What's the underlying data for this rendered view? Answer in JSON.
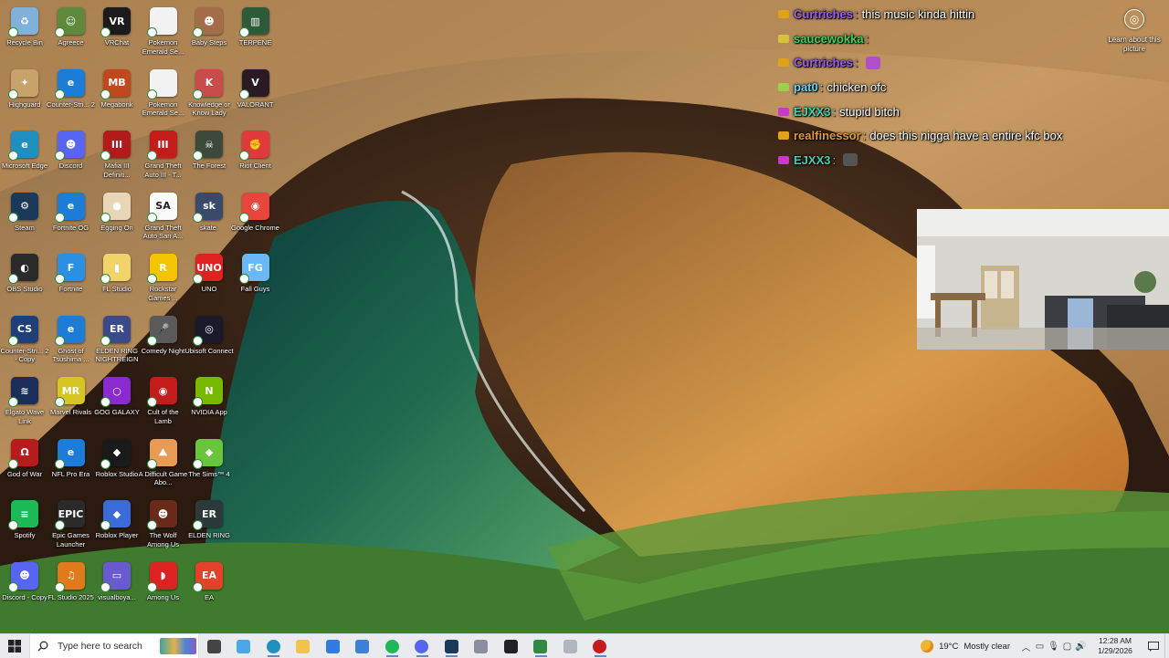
{
  "desktop": {
    "icons": [
      {
        "label": "Recycle Bin",
        "color": "#7fb1d9",
        "glyph": "♻"
      },
      {
        "label": "Agreece",
        "color": "#5f8a3e",
        "glyph": "☺"
      },
      {
        "label": "VRChat",
        "color": "#1b1b1b",
        "glyph": "VR"
      },
      {
        "label": "Pokemon Emerald Se...",
        "color": "#f2f2f2",
        "glyph": ""
      },
      {
        "label": "Baby Steps",
        "color": "#a36d4a",
        "glyph": "☻"
      },
      {
        "label": "TERPENE",
        "color": "#2f5a3a",
        "glyph": "▥"
      },
      {
        "label": "Highguard",
        "color": "#c9a26b",
        "glyph": "✦"
      },
      {
        "label": "Counter-Stri... 2",
        "color": "#1b7dd8",
        "glyph": "e"
      },
      {
        "label": "Megabonk",
        "color": "#c1481e",
        "glyph": "MB"
      },
      {
        "label": "Pokemon Emerald Se...",
        "color": "#f2f2f2",
        "glyph": ""
      },
      {
        "label": "Knowledge or Know Lady",
        "color": "#c94b4b",
        "glyph": "K"
      },
      {
        "label": "VALORANT",
        "color": "#2a1a24",
        "glyph": "V"
      },
      {
        "label": "Microsoft Edge",
        "color": "#1f8fbf",
        "glyph": "e"
      },
      {
        "label": "Discord",
        "color": "#5865f2",
        "glyph": "☻"
      },
      {
        "label": "Mafia III Definiti...",
        "color": "#b31b1b",
        "glyph": "III"
      },
      {
        "label": "Grand Theft Auto III - T...",
        "color": "#c41b1b",
        "glyph": "III"
      },
      {
        "label": "The Forest",
        "color": "#3b4a3b",
        "glyph": "☠"
      },
      {
        "label": "Riot Client",
        "color": "#e03a3a",
        "glyph": "✊"
      },
      {
        "label": "Steam",
        "color": "#1b3a5a",
        "glyph": "⚙"
      },
      {
        "label": "Fortnite OG",
        "color": "#1b7dd8",
        "glyph": "e"
      },
      {
        "label": "Egging On",
        "color": "#e9d6b8",
        "glyph": "●"
      },
      {
        "label": "Grand Theft Auto San A...",
        "color": "#fafafa",
        "glyph": "SA"
      },
      {
        "label": "skate.",
        "color": "#3a4a6a",
        "glyph": "sk"
      },
      {
        "label": "Google Chrome",
        "color": "#e8453c",
        "glyph": "◉"
      },
      {
        "label": "OBS Studio",
        "color": "#2a2a2a",
        "glyph": "◐"
      },
      {
        "label": "Fortnite",
        "color": "#2b8fe3",
        "glyph": "F"
      },
      {
        "label": "FL Studio",
        "color": "#f1d36a",
        "glyph": "▮"
      },
      {
        "label": "Rockstar Games ...",
        "color": "#f5c400",
        "glyph": "R"
      },
      {
        "label": "UNO",
        "color": "#d22",
        "glyph": "UNO"
      },
      {
        "label": "Fall Guys",
        "color": "#6ab8f5",
        "glyph": "FG"
      },
      {
        "label": "Counter-Stri... 2 - Copy",
        "color": "#1e3f7a",
        "glyph": "CS"
      },
      {
        "label": "Ghost of Tsushima ...",
        "color": "#1b7dd8",
        "glyph": "e"
      },
      {
        "label": "ELDEN RING NIGHTREIGN",
        "color": "#3a4a8a",
        "glyph": "ER"
      },
      {
        "label": "Comedy Night",
        "color": "#5a5a5a",
        "glyph": "🎤"
      },
      {
        "label": "Ubisoft Connect",
        "color": "#1a1a2a",
        "glyph": "◎"
      },
      {
        "label": "Elgato Wave Link",
        "color": "#1b2e5a",
        "glyph": "≋"
      },
      {
        "label": "Marvel Rivals",
        "color": "#d7c521",
        "glyph": "MR"
      },
      {
        "label": "GOG GALAXY",
        "color": "#8a2ad0",
        "glyph": "○"
      },
      {
        "label": "Cult of the Lamb",
        "color": "#c41b1b",
        "glyph": "◉"
      },
      {
        "label": "NVIDIA App",
        "color": "#76b900",
        "glyph": "N"
      },
      {
        "label": "God of War",
        "color": "#b81b1b",
        "glyph": "Ω"
      },
      {
        "label": "NFL Pro Era",
        "color": "#1b7dd8",
        "glyph": "e"
      },
      {
        "label": "Roblox Studio",
        "color": "#1a1a1a",
        "glyph": "◆"
      },
      {
        "label": "A Difficult Game Abo...",
        "color": "#e79b55",
        "glyph": "⛰"
      },
      {
        "label": "The Sims™ 4",
        "color": "#6ac43c",
        "glyph": "◆"
      },
      {
        "label": "Spotify",
        "color": "#1db954",
        "glyph": "≡"
      },
      {
        "label": "Epic Games Launcher",
        "color": "#2a2a2a",
        "glyph": "EPIC"
      },
      {
        "label": "Roblox Player",
        "color": "#3a6bd8",
        "glyph": "◆"
      },
      {
        "label": "The Wolf Among Us",
        "color": "#6a2a1a",
        "glyph": "☻"
      },
      {
        "label": "ELDEN RING",
        "color": "#2a3a3a",
        "glyph": "ER"
      },
      {
        "label": "Discord - Copy",
        "color": "#5865f2",
        "glyph": "☻"
      },
      {
        "label": "FL Studio 2025",
        "color": "#e07a1b",
        "glyph": "♫"
      },
      {
        "label": "visualboya...",
        "color": "#6a5ad0",
        "glyph": "▭"
      },
      {
        "label": "Among Us",
        "color": "#d22",
        "glyph": "◗"
      },
      {
        "label": "EA",
        "color": "#e2412a",
        "glyph": "EA"
      }
    ]
  },
  "chat": {
    "messages": [
      {
        "user": "Curtriches",
        "user_color": "#9b5cf0",
        "badge_color": "#e0a21b",
        "text": "this music kinda hittin",
        "emote": ""
      },
      {
        "user": "saucewokka",
        "user_color": "#3dd15c",
        "badge_color": "#d8c23c",
        "text": "",
        "emote": ""
      },
      {
        "user": "Curtriches",
        "user_color": "#9b5cf0",
        "badge_color": "#e0a21b",
        "text": "",
        "emote": "#b050c8"
      },
      {
        "user": "pat0",
        "user_color": "#6ad0f0",
        "badge_color": "#9bd04a",
        "text": "chicken ofc",
        "emote": ""
      },
      {
        "user": "EJXX3",
        "user_color": "#3bd1b0",
        "badge_color": "#c83bc8",
        "text": "stupid bitch",
        "emote": ""
      },
      {
        "user": "realfinessor",
        "user_color": "#e09a3a",
        "badge_color": "#e0a21b",
        "text": "does this nigga have a entire kfc box",
        "emote": ""
      },
      {
        "user": "EJXX3",
        "user_color": "#3bd1b0",
        "badge_color": "#c83bc8",
        "text": "",
        "emote": "#555"
      }
    ]
  },
  "learn_about": {
    "label": "Learn about this picture"
  },
  "taskbar": {
    "search_placeholder": "Type here to search",
    "apps": [
      {
        "name": "task-view",
        "color": "#444",
        "running": false
      },
      {
        "name": "copilot",
        "color": "#4aa8e8",
        "running": false
      },
      {
        "name": "edge",
        "color": "#1f8fbf",
        "running": true
      },
      {
        "name": "file-explorer",
        "color": "#f2c14e",
        "running": false
      },
      {
        "name": "store",
        "color": "#2f7be0",
        "running": false
      },
      {
        "name": "outlook",
        "color": "#3b82d8",
        "running": false
      },
      {
        "name": "spotify",
        "color": "#1db954",
        "running": true
      },
      {
        "name": "discord",
        "color": "#5865f2",
        "running": true
      },
      {
        "name": "steam",
        "color": "#1b3a5a",
        "running": true
      },
      {
        "name": "app-window",
        "color": "#8a8fa0",
        "running": false
      },
      {
        "name": "elgato",
        "color": "#222",
        "running": false
      },
      {
        "name": "xbox",
        "color": "#2e8b3f",
        "running": true
      },
      {
        "name": "cloud-app",
        "color": "#b0b6c0",
        "running": false
      },
      {
        "name": "obs",
        "color": "#c41b1b",
        "running": true
      }
    ],
    "weather": {
      "temp": "19°C",
      "condition": "Mostly clear"
    },
    "clock": {
      "time": "12:28 AM",
      "date": "1/29/2026"
    }
  }
}
